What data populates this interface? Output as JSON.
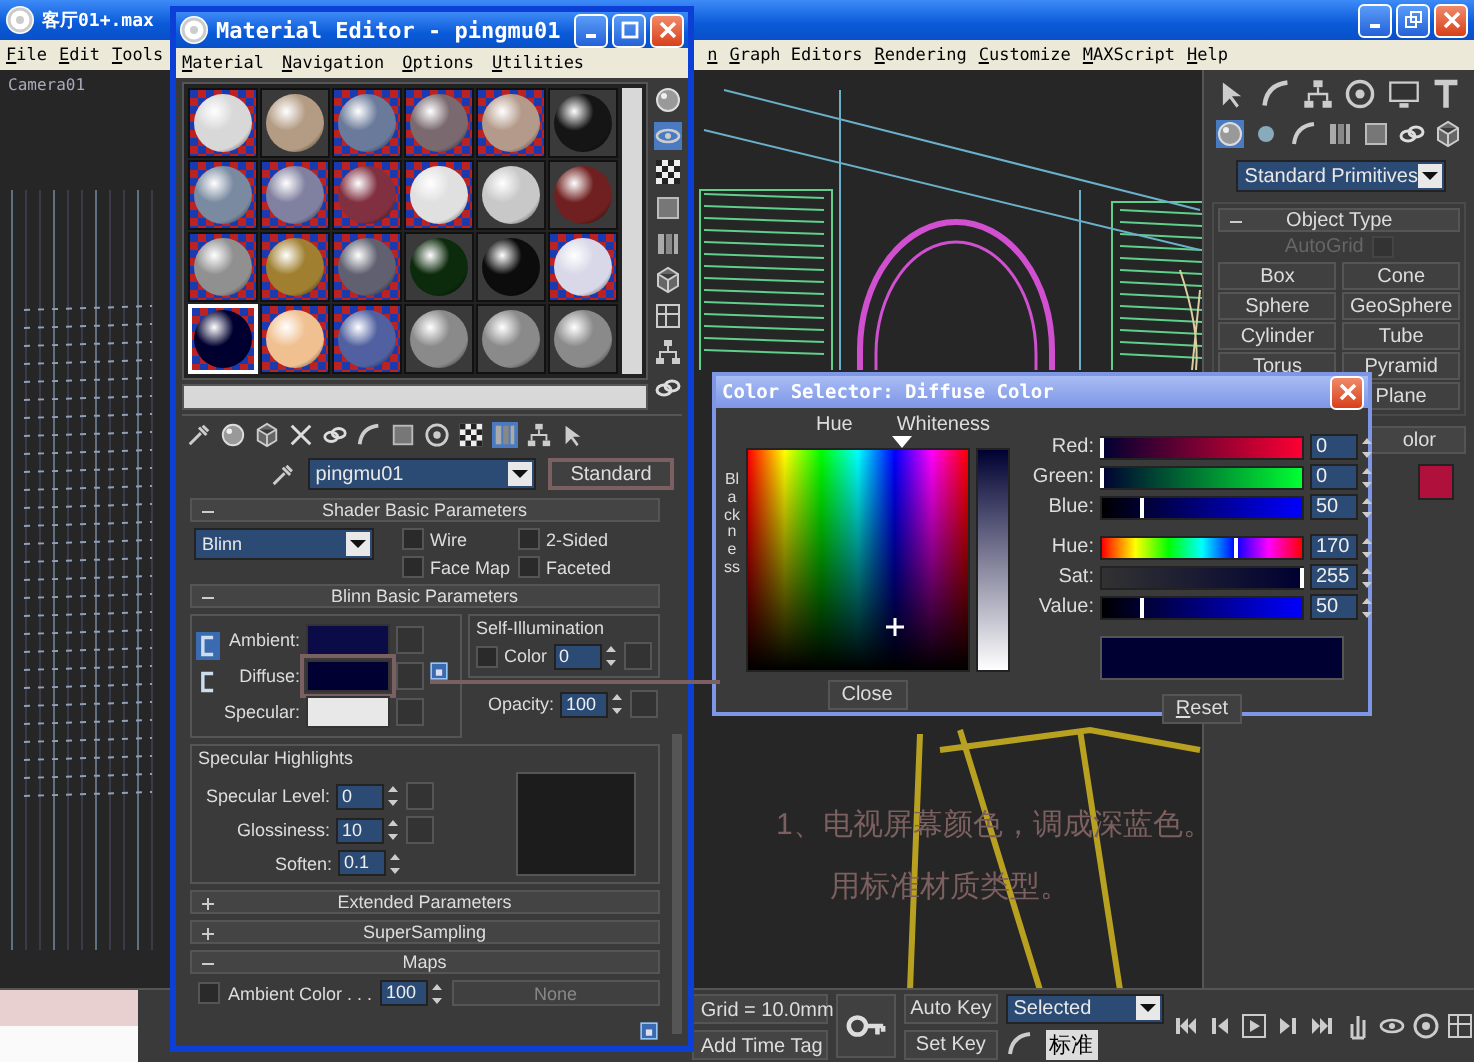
{
  "main_window": {
    "title": "客厅01+.max",
    "menu": [
      "File",
      "Edit",
      "Tools",
      "n",
      "Graph Editors",
      "Rendering",
      "Customize",
      "MAXScript",
      "Help"
    ]
  },
  "viewport": {
    "label": "Camera01",
    "notes": [
      "1、电视屏幕颜色，调成深蓝色。",
      "用标准材质类型。"
    ]
  },
  "command_panel": {
    "category": "Standard Primitives",
    "object_type": {
      "title": "Object Type",
      "expanded": true,
      "autogrid": {
        "label": "AutoGrid",
        "checked": false,
        "disabled": true
      },
      "buttons": [
        [
          "Box",
          "Cone"
        ],
        [
          "Sphere",
          "GeoSphere"
        ],
        [
          "Cylinder",
          "Tube"
        ],
        [
          "Torus",
          "Pyramid"
        ],
        [
          "Plane"
        ]
      ]
    },
    "name_and_color": {
      "title": "olor",
      "color": "#b0103c"
    }
  },
  "material_editor": {
    "title": "Material Editor - pingmu01",
    "menu": [
      "Material",
      "Navigation",
      "Options",
      "Utilities"
    ],
    "slots": [
      {
        "color": "#d8d8d8",
        "background": true,
        "selected": false
      },
      {
        "color": "#b49c84",
        "background": false,
        "selected": false
      },
      {
        "color": "#6a7a9a",
        "background": true,
        "selected": false
      },
      {
        "color": "#7a6a70",
        "background": true,
        "selected": false
      },
      {
        "color": "#b49a8a",
        "background": true,
        "selected": false
      },
      {
        "color": "#151515",
        "background": false,
        "selected": false
      },
      {
        "color": "#7a8aa0",
        "background": true,
        "selected": false
      },
      {
        "color": "#8080a0",
        "background": true,
        "selected": false
      },
      {
        "color": "#803040",
        "background": true,
        "selected": false
      },
      {
        "color": "#e0e0e0",
        "background": true,
        "selected": false
      },
      {
        "color": "#c8c8c8",
        "background": false,
        "selected": false
      },
      {
        "color": "#702020",
        "background": false,
        "selected": false
      },
      {
        "color": "#909090",
        "background": true,
        "selected": false
      },
      {
        "color": "#a08030",
        "background": true,
        "selected": false
      },
      {
        "color": "#606070",
        "background": true,
        "selected": false
      },
      {
        "color": "#0c2a0c",
        "background": false,
        "selected": false
      },
      {
        "color": "#0c0c0c",
        "background": false,
        "selected": false
      },
      {
        "color": "#d8d8e8",
        "background": true,
        "selected": false
      },
      {
        "color": "#000030",
        "background": true,
        "selected": true
      },
      {
        "color": "#f0c090",
        "background": true,
        "selected": false
      },
      {
        "color": "#5060a0",
        "background": true,
        "selected": false
      },
      {
        "color": "#8a8a8a",
        "background": false,
        "selected": false
      },
      {
        "color": "#8a8a8a",
        "background": false,
        "selected": false
      },
      {
        "color": "#8a8a8a",
        "background": false,
        "selected": false
      }
    ],
    "name": "pingmu01",
    "type": "Standard",
    "shader_basic": {
      "title": "Shader Basic Parameters",
      "expanded": true,
      "shader": "Blinn",
      "options": [
        {
          "label": "Wire",
          "checked": false
        },
        {
          "label": "2-Sided",
          "checked": false
        },
        {
          "label": "Face Map",
          "checked": false
        },
        {
          "label": "Faceted",
          "checked": false
        }
      ]
    },
    "blinn_basic": {
      "title": "Blinn Basic Parameters",
      "expanded": true,
      "colors": [
        {
          "label": "Ambient:",
          "color": "#0b0b48",
          "selected": false
        },
        {
          "label": "Diffuse:",
          "color": "#000032",
          "selected": true
        },
        {
          "label": "Specular:",
          "color": "#e8e8e8",
          "selected": false
        }
      ],
      "self_illumination": {
        "title": "Self-Illumination",
        "label": "Color",
        "checked": false,
        "value": "0"
      },
      "opacity": {
        "label": "Opacity:",
        "value": "100"
      },
      "specular_highlights": {
        "title": "Specular Highlights",
        "fields": [
          {
            "label": "Specular Level:",
            "value": "0"
          },
          {
            "label": "Glossiness:",
            "value": "10"
          },
          {
            "label": "Soften:",
            "value": "0.1"
          }
        ]
      }
    },
    "rollouts": [
      {
        "title": "Extended Parameters",
        "expanded": false
      },
      {
        "title": "SuperSampling",
        "expanded": false
      },
      {
        "title": "Maps",
        "expanded": true
      }
    ],
    "maps": [
      {
        "label": "Ambient Color . . .",
        "checked": false,
        "amount": "100",
        "map": "None"
      }
    ]
  },
  "color_selector": {
    "title": "Color Selector: Diffuse Color",
    "hue_label": "Hue",
    "whiteness_label": "Whiteness",
    "blackness_label": "Blackness",
    "sliders": [
      {
        "kind": "red",
        "label": "Red:",
        "value": "0",
        "level": 0
      },
      {
        "kind": "green",
        "label": "Green:",
        "value": "0",
        "level": 0
      },
      {
        "kind": "blue",
        "label": "Blue:",
        "value": "50",
        "level": 0.196
      },
      {
        "kind": "hue",
        "label": "Hue:",
        "value": "170",
        "level": 0.667
      },
      {
        "kind": "sat",
        "label": "Sat:",
        "value": "255",
        "level": 1
      },
      {
        "kind": "value",
        "label": "Value:",
        "value": "50",
        "level": 0.196
      }
    ],
    "color": "#000032",
    "buttons": [
      "Close",
      "Reset"
    ]
  },
  "status_bar": {
    "grid": "Grid = 10.0mm",
    "time_tag": "Add Time Tag",
    "auto_key": {
      "label": "Auto Key",
      "on": false
    },
    "set_key": "Set Key",
    "key_filter": "Selected",
    "ime": "标准"
  }
}
